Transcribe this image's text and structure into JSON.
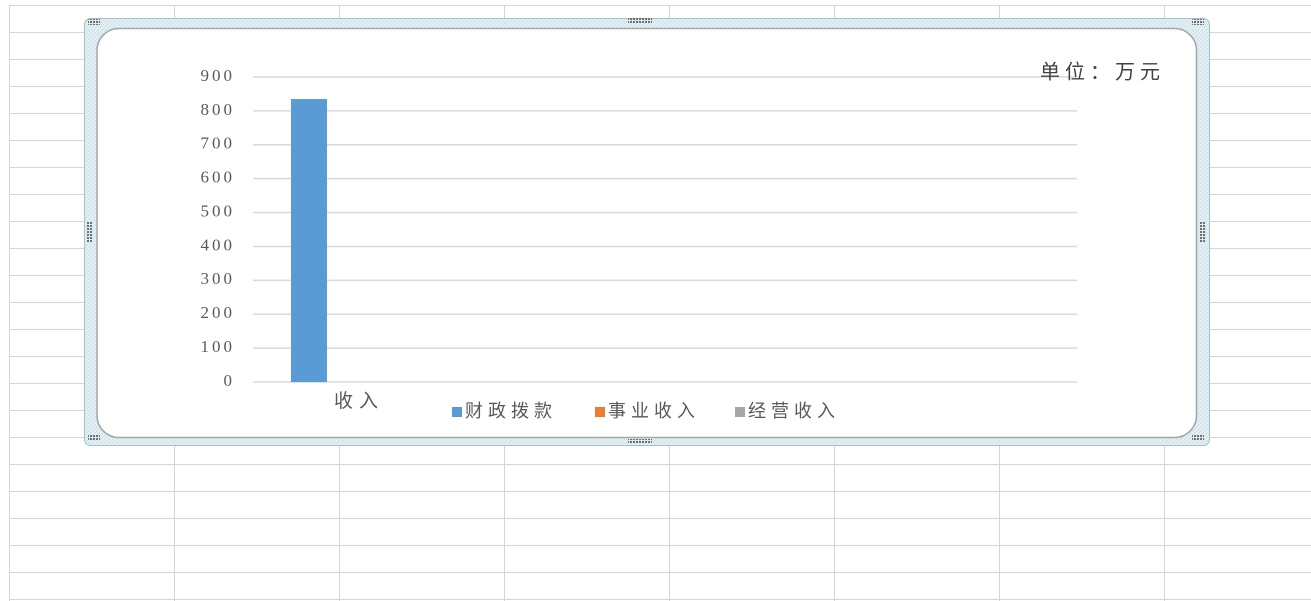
{
  "chart_data": {
    "type": "bar",
    "categories": [
      "收入"
    ],
    "series": [
      {
        "name": "财政拨款",
        "values": [
          835
        ],
        "color": "#5b9bd5"
      },
      {
        "name": "事业收入",
        "values": [
          0
        ],
        "color": "#ed7d31"
      },
      {
        "name": "经营收入",
        "values": [
          0
        ],
        "color": "#a5a5a5"
      }
    ],
    "unit_label": "单位：万元",
    "ylim": [
      0,
      900
    ],
    "yticks": [
      0,
      100,
      200,
      300,
      400,
      500,
      600,
      700,
      800,
      900
    ],
    "grid": true,
    "legend": "bottom"
  },
  "colors": {
    "sheet_gridline": "#d5d5d5",
    "chart_gridline": "#d9d9d9",
    "axis_text": "#595959",
    "selection_frame": "#e3f0f3",
    "chart_border": "#a6a6a6"
  }
}
